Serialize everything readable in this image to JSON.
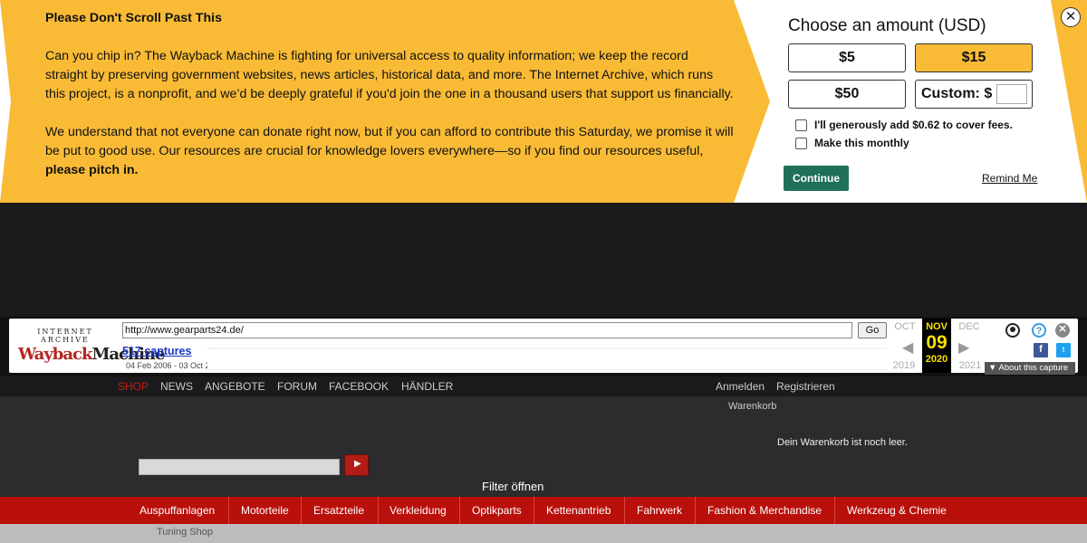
{
  "donation": {
    "heading": "Please Don't Scroll Past This",
    "paragraph1": "Can you chip in? The Wayback Machine is fighting for universal access to quality information; we keep the record straight by preserving government websites, news articles, historical data, and more. The Internet Archive, which runs this project, is a nonprofit, and we’d be deeply grateful if you'd join the one in a thousand users that support us financially.",
    "paragraph2": "We understand that not everyone can donate right now, but if you can afford to contribute this Saturday, we promise it will be put to good use. Our resources are crucial for knowledge lovers everywhere—so if you find our resources useful,",
    "paragraph2_bold": "please pitch in.",
    "form_title": "Choose an amount (USD)",
    "amounts": [
      "$5",
      "$15",
      "$50"
    ],
    "selected_amount": "$15",
    "custom_label": "Custom: $",
    "fee_checkbox": "I'll generously add $0.62 to cover fees.",
    "monthly_checkbox": "Make this monthly",
    "continue_label": "Continue",
    "remind_label": "Remind Me",
    "colors": {
      "banner": "#f9bb36",
      "continue": "#206f5b"
    }
  },
  "wayback": {
    "logo_top": "INTERNET ARCHIVE",
    "logo_main_red": "Wayback",
    "logo_main_black": "Machine",
    "url": "http://www.gearparts24.de/",
    "go_label": "Go",
    "captures": "517 captures",
    "date_range": "04 Feb 2006 - 03 Oct 2",
    "prev_month": "OCT",
    "current_month": "NOV",
    "next_month": "DEC",
    "current_day": "09",
    "prev_year": "2019",
    "current_year": "2020",
    "next_year": "2021",
    "about_label": "About this capture"
  },
  "site": {
    "top_nav": [
      "SHOP",
      "NEWS",
      "ANGEBOTE",
      "FORUM",
      "FACEBOOK",
      "HÄNDLER"
    ],
    "account_links": [
      "Anmelden",
      "Registrieren"
    ],
    "cart_label": "Warenkorb",
    "cart_empty": "Dein Warenkorb ist noch leer.",
    "filter_label": "Filter öffnen",
    "categories": [
      "Auspuffanlagen",
      "Motorteile",
      "Ersatzteile",
      "Verkleidung",
      "Optikparts",
      "Kettenantrieb",
      "Fahrwerk",
      "Fashion & Merchandise",
      "Werkzeug & Chemie"
    ],
    "breadcrumb": "Tuning Shop",
    "colors": {
      "accent": "#b9100b"
    }
  }
}
